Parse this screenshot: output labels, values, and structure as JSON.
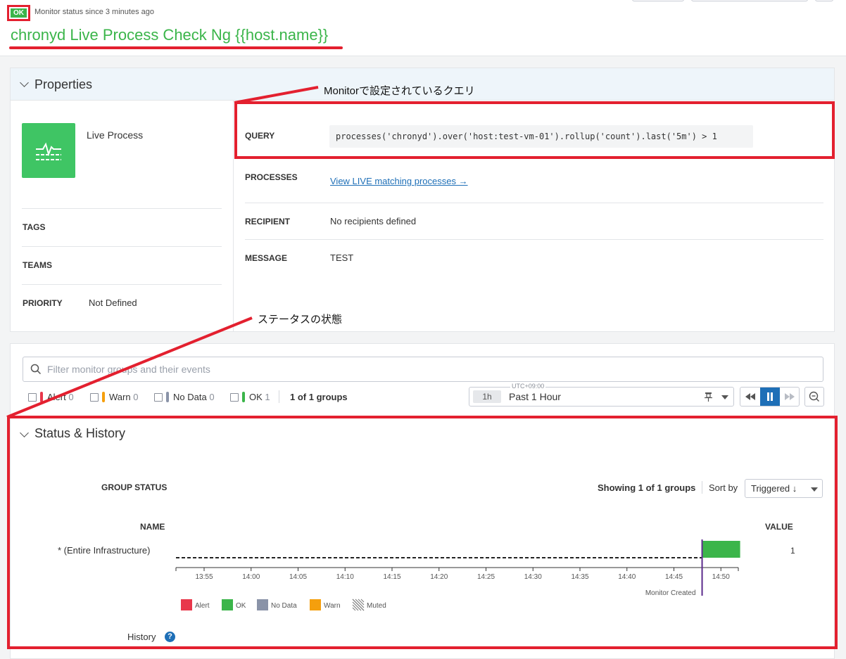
{
  "header": {
    "status_badge": "OK",
    "status_since": "Monitor status since 3 minutes ago",
    "title": "chronyd Live Process Check Ng {{host.name}}"
  },
  "properties": {
    "section_title": "Properties",
    "monitor_type": "Live Process",
    "tags_label": "TAGS",
    "teams_label": "TEAMS",
    "priority_label": "PRIORITY",
    "priority_value": "Not Defined",
    "query_label": "QUERY",
    "query_value": "processes('chronyd').over('host:test-vm-01').rollup('count').last('5m') > 1",
    "processes_label": "PROCESSES",
    "processes_link": "View LIVE matching processes →",
    "recipient_label": "RECIPIENT",
    "recipient_value": "No recipients defined",
    "message_label": "MESSAGE",
    "message_value": "TEST"
  },
  "annotations": {
    "query_note": "Monitorで設定されているクエリ",
    "status_note": "ステータスの状態"
  },
  "filters": {
    "search_placeholder": "Filter monitor groups and their events",
    "statuses": [
      {
        "label": "Alert",
        "count": "0",
        "color": "#e8374b"
      },
      {
        "label": "Warn",
        "count": "0",
        "color": "#f59f0d"
      },
      {
        "label": "No Data",
        "count": "0",
        "color": "#8a93a8"
      },
      {
        "label": "OK",
        "count": "1",
        "color": "#3bb54a"
      }
    ],
    "groups_count": "1 of 1 groups"
  },
  "time_range": {
    "timezone": "UTC+09:00",
    "badge": "1h",
    "label": "Past 1 Hour"
  },
  "status_history": {
    "section_title": "Status & History",
    "group_status_label": "GROUP STATUS",
    "showing": "Showing 1 of 1 groups",
    "sort_by_label": "Sort by",
    "sort_value": "Triggered ↓",
    "name_header": "NAME",
    "value_header": "VALUE",
    "group_name": "* (Entire Infrastructure)",
    "group_value": "1",
    "monitor_created": "Monitor Created",
    "history_label": "History",
    "legend": [
      {
        "label": "Alert",
        "color": "#e8374b"
      },
      {
        "label": "OK",
        "color": "#3bb54a"
      },
      {
        "label": "No Data",
        "color": "#8a93a8"
      },
      {
        "label": "Warn",
        "color": "#f59f0d"
      },
      {
        "label": "Muted",
        "color": "pattern"
      }
    ]
  },
  "chart_data": {
    "type": "timeline",
    "x_ticks": [
      "13:55",
      "14:00",
      "14:05",
      "14:10",
      "14:15",
      "14:20",
      "14:25",
      "14:30",
      "14:35",
      "14:40",
      "14:45",
      "14:50"
    ],
    "segments": [
      {
        "status": "No Data",
        "start": "13:52",
        "end": "14:48"
      },
      {
        "status": "OK",
        "start": "14:48",
        "end": "14:51"
      }
    ],
    "events": [
      {
        "label": "Monitor Created",
        "time": "14:48"
      }
    ]
  }
}
